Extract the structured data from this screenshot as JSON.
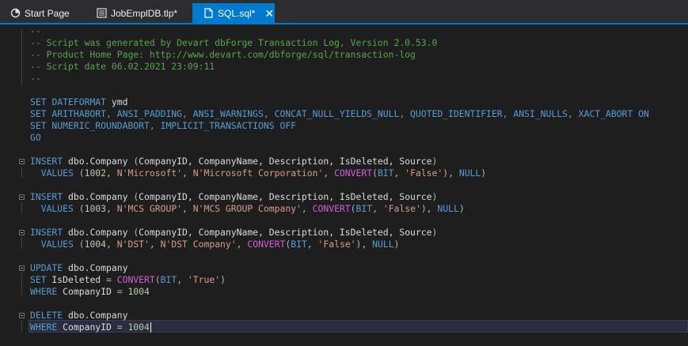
{
  "tabs": [
    {
      "label": "Start Page",
      "icon": "start-page-icon",
      "active": false
    },
    {
      "label": "JobEmplDB.tlp*",
      "icon": "transaction-log-icon",
      "active": false
    },
    {
      "label": "SQL.sql*",
      "icon": "sql-file-icon",
      "active": true
    }
  ],
  "colors": {
    "comment": "#57a64a",
    "keyword": "#569cd6",
    "function": "#d65fd6",
    "string": "#d69d85",
    "number": "#b5cea8",
    "accent": "#007acc"
  },
  "code_lines": [
    [
      {
        "t": "--",
        "c": "comment"
      }
    ],
    [
      {
        "t": "-- Script was generated by Devart dbForge Transaction Log, Version 2.0.53.0",
        "c": "comment"
      }
    ],
    [
      {
        "t": "-- Product Home Page: http://www.devart.com/dbforge/sql/transaction-log",
        "c": "comment"
      }
    ],
    [
      {
        "t": "-- Script date 06.02.2021 23:09:11",
        "c": "comment"
      }
    ],
    [
      {
        "t": "--",
        "c": "comment"
      }
    ],
    [],
    [
      {
        "t": "SET",
        "c": "kw"
      },
      {
        "t": " ",
        "c": "plain"
      },
      {
        "t": "DATEFORMAT",
        "c": "kw"
      },
      {
        "t": " ymd",
        "c": "plain"
      }
    ],
    [
      {
        "t": "SET ARITHABORT, ANSI_PADDING, ANSI_WARNINGS, CONCAT_NULL_YIELDS_NULL, QUOTED_IDENTIFIER, ANSI_NULLS, XACT_ABORT ON",
        "c": "kw"
      }
    ],
    [
      {
        "t": "SET NUMERIC_ROUNDABORT, IMPLICIT_TRANSACTIONS OFF",
        "c": "kw"
      }
    ],
    [
      {
        "t": "GO",
        "c": "kw"
      }
    ],
    [],
    [
      {
        "t": "INSERT",
        "c": "kw"
      },
      {
        "t": " dbo.Company ",
        "c": "plain"
      },
      {
        "t": "(",
        "c": "op"
      },
      {
        "t": "CompanyID, CompanyName, Description, IsDeleted, Source",
        "c": "plain"
      },
      {
        "t": ")",
        "c": "op"
      }
    ],
    [
      {
        "t": "  VALUES",
        "c": "kw"
      },
      {
        "t": " (",
        "c": "op"
      },
      {
        "t": "1002",
        "c": "num"
      },
      {
        "t": ", ",
        "c": "op"
      },
      {
        "t": "N'Microsoft'",
        "c": "str"
      },
      {
        "t": ", ",
        "c": "op"
      },
      {
        "t": "N'Microsoft Corporation'",
        "c": "str"
      },
      {
        "t": ", ",
        "c": "op"
      },
      {
        "t": "CONVERT",
        "c": "fn"
      },
      {
        "t": "(",
        "c": "op"
      },
      {
        "t": "BIT",
        "c": "kw"
      },
      {
        "t": ", ",
        "c": "op"
      },
      {
        "t": "'False'",
        "c": "str"
      },
      {
        "t": "), ",
        "c": "op"
      },
      {
        "t": "NULL",
        "c": "kw"
      },
      {
        "t": ")",
        "c": "op"
      }
    ],
    [],
    [
      {
        "t": "INSERT",
        "c": "kw"
      },
      {
        "t": " dbo.Company ",
        "c": "plain"
      },
      {
        "t": "(",
        "c": "op"
      },
      {
        "t": "CompanyID, CompanyName, Description, IsDeleted, Source",
        "c": "plain"
      },
      {
        "t": ")",
        "c": "op"
      }
    ],
    [
      {
        "t": "  VALUES",
        "c": "kw"
      },
      {
        "t": " (",
        "c": "op"
      },
      {
        "t": "1003",
        "c": "num"
      },
      {
        "t": ", ",
        "c": "op"
      },
      {
        "t": "N'MCS GROUP'",
        "c": "str"
      },
      {
        "t": ", ",
        "c": "op"
      },
      {
        "t": "N'MCS GROUP Company'",
        "c": "str"
      },
      {
        "t": ", ",
        "c": "op"
      },
      {
        "t": "CONVERT",
        "c": "fn"
      },
      {
        "t": "(",
        "c": "op"
      },
      {
        "t": "BIT",
        "c": "kw"
      },
      {
        "t": ", ",
        "c": "op"
      },
      {
        "t": "'False'",
        "c": "str"
      },
      {
        "t": "), ",
        "c": "op"
      },
      {
        "t": "NULL",
        "c": "kw"
      },
      {
        "t": ")",
        "c": "op"
      }
    ],
    [],
    [
      {
        "t": "INSERT",
        "c": "kw"
      },
      {
        "t": " dbo.Company ",
        "c": "plain"
      },
      {
        "t": "(",
        "c": "op"
      },
      {
        "t": "CompanyID, CompanyName, Description, IsDeleted, Source",
        "c": "plain"
      },
      {
        "t": ")",
        "c": "op"
      }
    ],
    [
      {
        "t": "  VALUES",
        "c": "kw"
      },
      {
        "t": " (",
        "c": "op"
      },
      {
        "t": "1004",
        "c": "num"
      },
      {
        "t": ", ",
        "c": "op"
      },
      {
        "t": "N'DST'",
        "c": "str"
      },
      {
        "t": ", ",
        "c": "op"
      },
      {
        "t": "N'DST Company'",
        "c": "str"
      },
      {
        "t": ", ",
        "c": "op"
      },
      {
        "t": "CONVERT",
        "c": "fn"
      },
      {
        "t": "(",
        "c": "op"
      },
      {
        "t": "BIT",
        "c": "kw"
      },
      {
        "t": ", ",
        "c": "op"
      },
      {
        "t": "'False'",
        "c": "str"
      },
      {
        "t": "), ",
        "c": "op"
      },
      {
        "t": "NULL",
        "c": "kw"
      },
      {
        "t": ")",
        "c": "op"
      }
    ],
    [],
    [
      {
        "t": "UPDATE",
        "c": "kw"
      },
      {
        "t": " dbo.Company",
        "c": "plain"
      }
    ],
    [
      {
        "t": "SET",
        "c": "kw"
      },
      {
        "t": " IsDeleted ",
        "c": "plain"
      },
      {
        "t": "= ",
        "c": "op"
      },
      {
        "t": "CONVERT",
        "c": "fn"
      },
      {
        "t": "(",
        "c": "op"
      },
      {
        "t": "BIT",
        "c": "kw"
      },
      {
        "t": ", ",
        "c": "op"
      },
      {
        "t": "'True'",
        "c": "str"
      },
      {
        "t": ")",
        "c": "op"
      }
    ],
    [
      {
        "t": "WHERE",
        "c": "kw"
      },
      {
        "t": " CompanyID ",
        "c": "plain"
      },
      {
        "t": "= ",
        "c": "op"
      },
      {
        "t": "1004",
        "c": "num"
      }
    ],
    [],
    [
      {
        "t": "DELETE",
        "c": "kw"
      },
      {
        "t": " dbo.Company",
        "c": "plain"
      }
    ],
    [
      {
        "t": "WHERE",
        "c": "kw"
      },
      {
        "t": " CompanyID ",
        "c": "plain"
      },
      {
        "t": "= ",
        "c": "op"
      },
      {
        "t": "1004",
        "c": "num"
      }
    ]
  ]
}
